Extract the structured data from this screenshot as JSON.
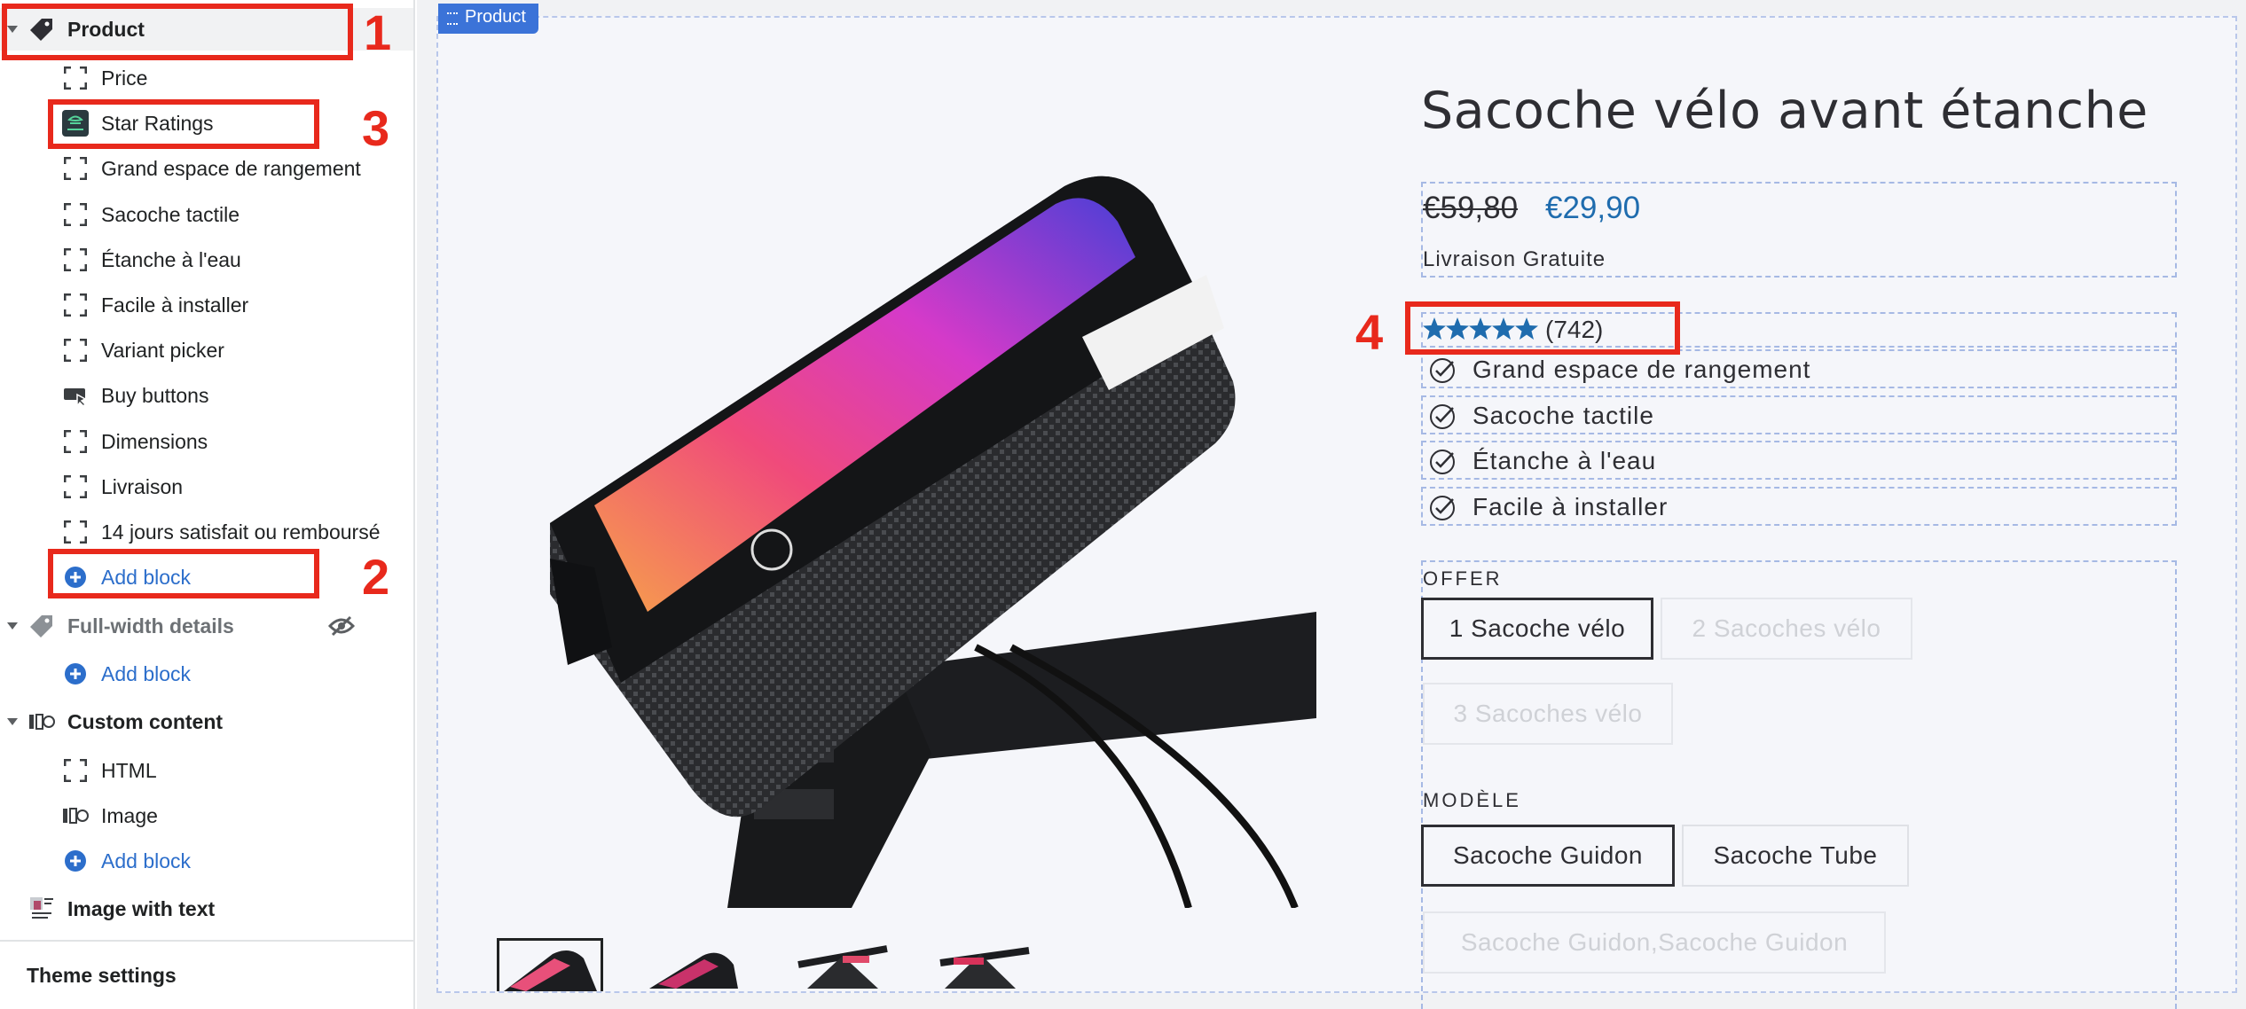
{
  "sidebar": {
    "product": {
      "label": "Product"
    },
    "product_blocks": [
      {
        "label": "Price",
        "icon": "dashed-square-icon"
      },
      {
        "label": "Star Ratings",
        "icon": "star-ratings-app-icon"
      },
      {
        "label": "Grand espace de rangement",
        "icon": "dashed-square-icon"
      },
      {
        "label": "Sacoche tactile",
        "icon": "dashed-square-icon"
      },
      {
        "label": "Étanche à l'eau",
        "icon": "dashed-square-icon"
      },
      {
        "label": "Facile à installer",
        "icon": "dashed-square-icon"
      },
      {
        "label": "Variant picker",
        "icon": "dashed-square-icon"
      },
      {
        "label": "Buy buttons",
        "icon": "buy-buttons-icon"
      },
      {
        "label": "Dimensions",
        "icon": "dashed-square-icon"
      },
      {
        "label": "Livraison",
        "icon": "dashed-square-icon"
      },
      {
        "label": "14 jours satisfait ou remboursé",
        "icon": "dashed-square-icon"
      }
    ],
    "add_block_label": "Add block",
    "full_width": {
      "label": "Full-width details",
      "hidden": true
    },
    "custom_content": {
      "label": "Custom content"
    },
    "custom_blocks": [
      {
        "label": "HTML",
        "icon": "dashed-square-icon"
      },
      {
        "label": "Image",
        "icon": "image-gallery-icon"
      }
    ],
    "image_with_text": {
      "label": "Image with text"
    },
    "theme_settings": "Theme settings"
  },
  "preview": {
    "section_tag": "Product",
    "title": "Sacoche vélo avant étanche",
    "old_price": "€59,80",
    "new_price": "€29,90",
    "delivery": "Livraison Gratuite",
    "rating": {
      "stars": 5,
      "count": "(742)"
    },
    "features": [
      "Grand espace de rangement",
      "Sacoche tactile",
      "Étanche à l'eau",
      "Facile à installer"
    ],
    "offer": {
      "label": "OFFER",
      "options": [
        {
          "label": "1 Sacoche vélo",
          "state": "selected"
        },
        {
          "label": "2 Sacoches vélo",
          "state": "unavailable"
        },
        {
          "label": "3 Sacoches vélo",
          "state": "unavailable"
        }
      ]
    },
    "model": {
      "label": "MODÈLE",
      "options": [
        {
          "label": "Sacoche Guidon",
          "state": "selected"
        },
        {
          "label": "Sacoche Tube",
          "state": "available"
        },
        {
          "label": "Sacoche Guidon,Sacoche Guidon",
          "state": "unavailable"
        }
      ]
    },
    "thumbnail_count": 4
  },
  "annotations": [
    "1",
    "2",
    "3",
    "4"
  ],
  "colors": {
    "accent_blue": "#2c6ecb",
    "price_blue": "#1f6cae",
    "star_blue": "#1f6cae",
    "annotation_red": "#e8291c"
  }
}
